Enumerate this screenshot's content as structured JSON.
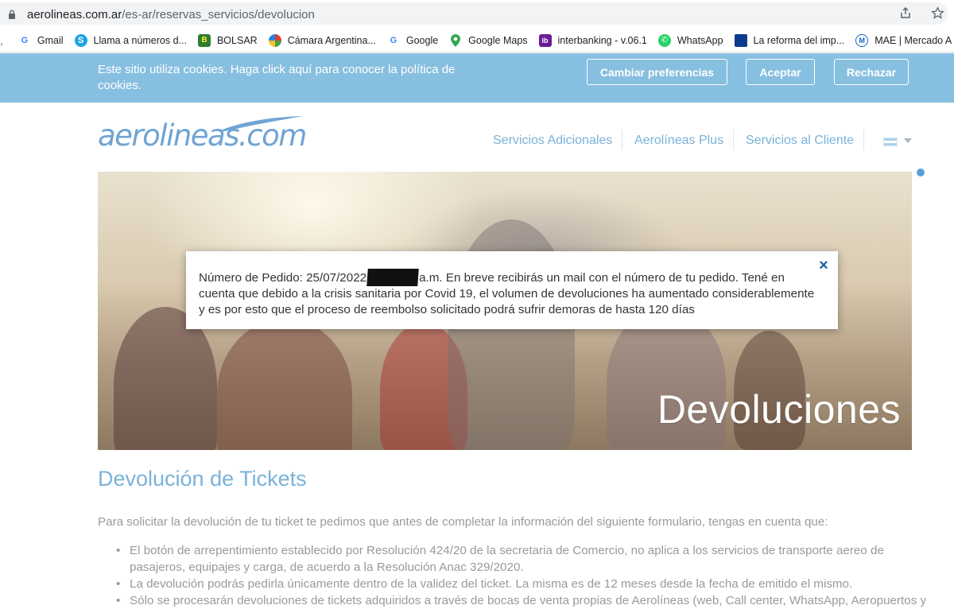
{
  "browser": {
    "url_domain": "aerolineas.com.ar",
    "url_path": "/es-ar/reservas_servicios/devolucion"
  },
  "bookmarks": [
    {
      "label": "Gmail",
      "icon": "google-icon"
    },
    {
      "label": "Llama a números d...",
      "icon": "skype-icon"
    },
    {
      "label": "BOLSAR",
      "icon": "bolsar-icon"
    },
    {
      "label": "Cámara Argentina...",
      "icon": "camara-icon"
    },
    {
      "label": "Google",
      "icon": "google-icon"
    },
    {
      "label": "Google Maps",
      "icon": "maps-pin-icon"
    },
    {
      "label": "interbanking - v.06.1",
      "icon": "interbanking-icon"
    },
    {
      "label": "WhatsApp",
      "icon": "whatsapp-icon"
    },
    {
      "label": "La reforma del imp...",
      "icon": "bookmark-site-icon"
    },
    {
      "label": "MAE | Mercado A",
      "icon": "mae-icon"
    }
  ],
  "cookie_bar": {
    "text": "Este sitio utiliza cookies. Haga click aquí para conocer la política de cookies.",
    "preferences": "Cambiar preferencias",
    "accept": "Aceptar",
    "reject": "Rechazar"
  },
  "header": {
    "logo": "aerolineas.com",
    "nav": [
      "Servicios Adicionales",
      "Aerolíneas Plus",
      "Servicios al Cliente"
    ]
  },
  "hero": {
    "title": "Devoluciones"
  },
  "modal": {
    "text_before": "Número de Pedido: 25/07/2022",
    "text_after": "a.m. En breve recibirás un mail con el número de tu pedido. Tené en cuenta que debido a la crisis sanitaria por Covid 19, el volumen de devoluciones ha aumentado considerablemente y es por esto que el proceso de reembolso solicitado podrá sufrir demoras de hasta 120 días",
    "close": "×"
  },
  "content": {
    "heading": "Devolución de Tickets",
    "intro": "Para solicitar la devolución de tu ticket te pedimos que antes de completar la información del siguiente formulario, tengas en cuenta que:",
    "bullets": [
      "El botón de arrepentimiento establecido por Resolución 424/20 de la secretaria de Comercio, no aplica a los servicios de transporte aereo de pasajeros, equipajes y carga, de acuerdo a la Resolución Anac 329/2020.",
      "La devolución podrás pedirla únicamente dentro de la validez del ticket. La misma es de 12 meses desde la fecha de emitido el mismo.",
      "Sólo se procesarán devoluciones de tickets adquiridos a través de bocas de venta propias de Aerolíneas (web, Call center, WhatsApp, Aeropuertos y"
    ]
  },
  "colors": {
    "brand_blue": "#6fa4d4",
    "cookie_bar": "#87bfe0",
    "close_blue": "#1a5fa8"
  }
}
